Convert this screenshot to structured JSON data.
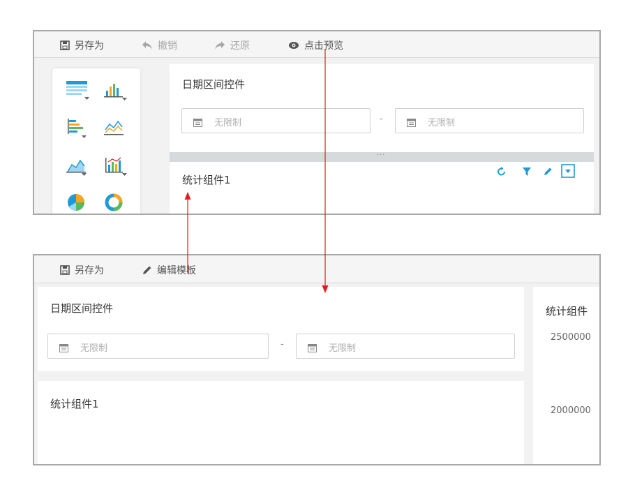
{
  "colors": {
    "arrow": "#e31c1c",
    "accent": "#1e9bd7",
    "disabled_text": "#a7a7a7",
    "placeholder": "#b0b0b0"
  },
  "top_panel": {
    "toolbar": {
      "save_as_label": "另存为",
      "undo_label": "撤销",
      "redo_label": "还原",
      "preview_label": "点击预览"
    },
    "chart_types": [
      {
        "icon": "table-chart-icon"
      },
      {
        "icon": "bar-chart-icon"
      },
      {
        "icon": "horizontal-bar-chart-icon"
      },
      {
        "icon": "line-chart-icon"
      },
      {
        "icon": "area-chart-icon"
      },
      {
        "icon": "combo-chart-icon"
      },
      {
        "icon": "pie-chart-icon"
      },
      {
        "icon": "donut-chart-icon"
      }
    ],
    "date_widget": {
      "title": "日期区间控件",
      "start_placeholder": "无限制",
      "separator": "-",
      "end_placeholder": "无限制"
    },
    "drag_handle": "···",
    "stat_widget": {
      "title": "统计组件1",
      "tools": [
        "refresh-icon",
        "filter-icon",
        "edit-icon",
        "dropdown-icon"
      ]
    }
  },
  "bottom_panel": {
    "toolbar": {
      "save_as_label": "另存为",
      "edit_template_label": "编辑模板"
    },
    "date_widget": {
      "title": "日期区间控件",
      "start_placeholder": "无限制",
      "separator": "-",
      "end_placeholder": "无限制"
    },
    "stat_widget": {
      "title": "统计组件1"
    },
    "right_widget": {
      "title": "统计组件",
      "values": [
        "2500000",
        "2000000"
      ]
    }
  }
}
